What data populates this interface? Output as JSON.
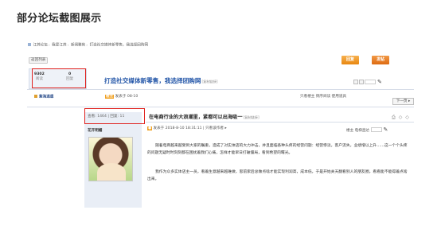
{
  "slide": {
    "title": "部分论坛截图展示"
  },
  "breadcrumb": [
    "江苏论坛",
    "我爱江苏",
    "新闻聚焦",
    "打造社交媒体新零售，我选择团购网"
  ],
  "toolbar": {
    "back_label": "返回列表",
    "reply_label": "回复",
    "post_label": "发帖"
  },
  "stats": {
    "views_num": "9302",
    "views_label": "阅读",
    "replies_num": "0",
    "replies_label": "回复"
  },
  "thread": {
    "title": "打造社交媒体新零售，我选择团购网",
    "copy_label": "[复制链接]",
    "first_user": "紫海逍遥",
    "first_tag": "楼主",
    "first_meta": "发表于 08-10",
    "first_right": "只看楼主  倒序阅读  使用道具",
    "next_label": "下一页 ▸"
  },
  "post": {
    "side_stats": "查看: 1464  |  回复: 11",
    "author": "花开明媚",
    "title": "在电商行业的大浪潮里，紧都可以出海吸一",
    "copy_label": "[复制链接]",
    "tools": "⎙ ◇ ◇",
    "meta": "发表于 2018-8-10 18:31:11  |  只看该作者 ▸",
    "meta_right": "楼主  电梯直达",
    "para1": "随着电商越来越受到大家的瞩重，造成了对实体店的大力冲击，并且面临各种头疼的经营问题：经营惨淡，客户流失，业绩增以上升……这一个个头疼的问题无疑时时刻刻都在困扰着我们心痛，怎样才能早日打破僵局，看到希望的曙光。",
    "para2": "我作为众多实体店主一员，看着生意越来越难做，思前索后总做点啥才能实现利润高，成本低，于是开始关天翻看别人的朋友圈，看看能不能得着点啥出来。"
  }
}
